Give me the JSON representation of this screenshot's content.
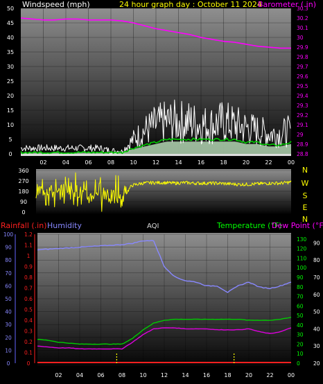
{
  "header": {
    "windspeed_label": "Windspeed (mph)",
    "title": "24 hour graph day : October 11 2024",
    "barometer_label": "Barometer (.in)"
  },
  "legend2": {
    "rainfall_label": "Rainfall (.in)",
    "humidity_label": "Humidity",
    "aqi_label": "AQI",
    "temperature_label": "Temperature (°F)",
    "dewpoint_label": "Dew Point (°F)"
  },
  "colors": {
    "wind": "#ffffff",
    "gust_avg": "#00cc00",
    "avg_band": "#c8f0c8",
    "barometer": "#ff00ff",
    "direction": "#ffff00",
    "temperature": "#00cc00",
    "dewpoint": "#dd00dd",
    "humidity": "#8888ff",
    "rain": "#ff2020",
    "axis_green": "#00ff00"
  },
  "chart_data": [
    {
      "type": "line",
      "title": "24 hour graph day : October 11 2024",
      "x_ticks": [
        "02",
        "04",
        "06",
        "08",
        "10",
        "12",
        "14",
        "16",
        "18",
        "20",
        "22",
        "00"
      ],
      "ylabel": "Windspeed (mph)",
      "ylim": [
        0,
        50
      ],
      "y_ticks": [
        0,
        5,
        10,
        15,
        20,
        25,
        30,
        35,
        40,
        45,
        50
      ],
      "y2label": "Barometer (.in)",
      "y2lim": [
        28.8,
        30.3
      ],
      "y2_ticks": [
        "28.8",
        "28.9",
        "29",
        "29.1",
        "29.2",
        "29.3",
        "29.4",
        "29.5",
        "29.6",
        "29.7",
        "29.8",
        "29.9",
        "30",
        "30.1",
        "30.2",
        "30.3"
      ],
      "x_hours": [
        0,
        1,
        2,
        3,
        4,
        5,
        6,
        7,
        8,
        9,
        10,
        11,
        12,
        13,
        14,
        15,
        16,
        17,
        18,
        19,
        20,
        21,
        22,
        23,
        24
      ],
      "series": [
        {
          "name": "Windspeed (mph)",
          "axis": "left",
          "values": [
            2,
            2,
            2,
            2,
            2,
            2,
            2,
            2,
            1,
            1,
            5,
            8,
            10,
            11,
            11,
            11,
            10,
            10,
            11,
            10,
            9,
            8,
            7,
            7,
            8
          ]
        },
        {
          "axis": "left",
          "values": [
            0.5,
            0.5,
            0.5,
            0.5,
            0.5,
            0.5,
            0.5,
            0.5,
            0.5,
            0.5,
            2,
            3,
            4,
            5,
            5,
            5,
            5,
            5,
            5,
            5,
            4,
            4,
            3,
            3,
            4
          ]
        },
        {
          "name": "Barometer (.in)",
          "axis": "right",
          "values": [
            30.2,
            30.19,
            30.18,
            30.18,
            30.19,
            30.19,
            30.18,
            30.18,
            30.18,
            30.17,
            30.15,
            30.12,
            30.09,
            30.07,
            30.05,
            30.03,
            30.0,
            29.98,
            29.96,
            29.95,
            29.93,
            29.91,
            29.9,
            29.89,
            29.89
          ]
        }
      ]
    },
    {
      "type": "line",
      "x_ticks": [
        "02",
        "04",
        "06",
        "08",
        "10",
        "12",
        "14",
        "16",
        "18",
        "20",
        "22",
        "00"
      ],
      "ylim": [
        0,
        360
      ],
      "y_ticks": [
        0,
        90,
        180,
        270,
        360
      ],
      "y2_ticks": [
        "N",
        "W",
        "S",
        "E",
        "N"
      ],
      "x_hours": [
        0,
        1,
        2,
        3,
        4,
        5,
        6,
        7,
        8,
        9,
        10,
        11,
        12,
        13,
        14,
        15,
        16,
        17,
        18,
        19,
        20,
        21,
        22,
        23,
        24
      ],
      "series": [
        {
          "values": [
            180,
            200,
            150,
            220,
            180,
            120,
            200,
            140,
            100,
            230,
            250,
            255,
            255,
            250,
            255,
            250,
            250,
            250,
            245,
            240,
            240,
            245,
            250,
            250,
            260
          ]
        }
      ]
    },
    {
      "type": "line",
      "x_ticks": [
        "02",
        "04",
        "06",
        "08",
        "10",
        "12",
        "14",
        "16",
        "18",
        "20",
        "22",
        "00"
      ],
      "y_left1_label": "Rainfall (.in)",
      "y_left1_ticks": [
        "0",
        "0.1",
        "0.2",
        "0.3",
        "0.4",
        "0.5",
        "0.6",
        "0.7",
        "0.8",
        "0.9",
        "1",
        "1.1",
        "1.2"
      ],
      "y_left1_lim": [
        0,
        1.2
      ],
      "y_left2_label": "Humidity",
      "y_left2_ticks": [
        0,
        10,
        20,
        30,
        40,
        50,
        60,
        70,
        80,
        90,
        100
      ],
      "y_left2_lim": [
        0,
        100
      ],
      "y_right1_label": "Temperature (°F)",
      "y_right1_ticks": [
        0,
        10,
        20,
        30,
        40,
        50,
        60,
        70,
        80,
        90,
        100,
        110,
        120,
        130
      ],
      "y_right1_lim": [
        0,
        135
      ],
      "y_right2_label": "Dew Point (°F)",
      "y_right2_ticks": [
        20,
        30,
        40,
        50,
        60,
        70,
        80,
        90
      ],
      "y_right2_lim": [
        20,
        95
      ],
      "x_hours": [
        0,
        1,
        2,
        3,
        4,
        5,
        6,
        7,
        8,
        9,
        10,
        11,
        12,
        13,
        14,
        15,
        16,
        17,
        18,
        19,
        20,
        21,
        22,
        23,
        24
      ],
      "series": [
        {
          "name": "Humidity",
          "axis": "left2",
          "values": [
            88,
            88.5,
            89,
            89.5,
            90,
            90.5,
            91,
            91.5,
            92,
            93,
            95,
            95,
            75,
            67,
            64,
            63,
            60,
            60,
            55,
            60,
            63,
            59,
            58,
            60,
            63
          ]
        },
        {
          "name": "Temperature (°F)",
          "axis": "right1",
          "values": [
            25,
            24,
            22,
            21,
            20,
            20,
            20,
            20,
            20,
            26,
            35,
            42,
            45,
            46,
            46,
            46,
            46,
            46,
            46,
            46,
            45,
            45,
            45,
            46,
            48
          ]
        },
        {
          "name": "Dew Point (°F)",
          "axis": "right1",
          "values": [
            18,
            17,
            16,
            16,
            15,
            15,
            15,
            15,
            15,
            22,
            30,
            36,
            37,
            37,
            36,
            36,
            36,
            35,
            35,
            35,
            36,
            33,
            31,
            33,
            37
          ]
        },
        {
          "name": "Rainfall (.in)",
          "axis": "left1",
          "values": [
            0,
            0,
            0,
            0,
            0,
            0,
            0,
            0,
            0,
            0,
            0,
            0,
            0,
            0,
            0,
            0,
            0,
            0,
            0,
            0,
            0,
            0,
            0,
            0,
            0
          ]
        }
      ]
    }
  ]
}
